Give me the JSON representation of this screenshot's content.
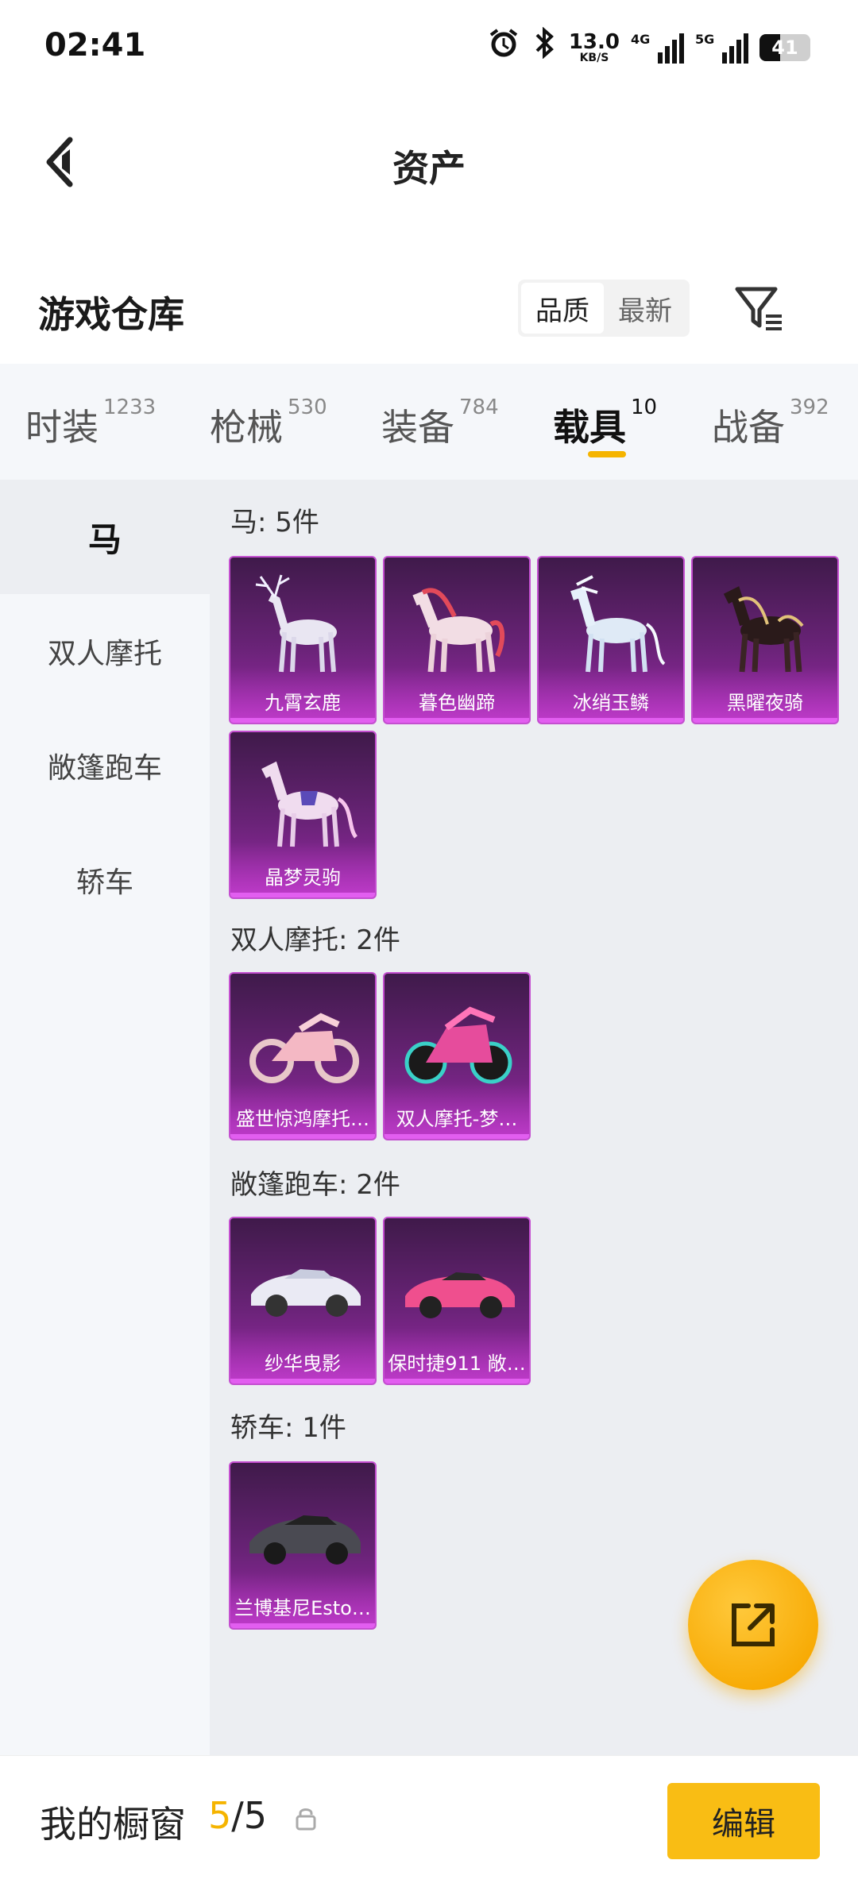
{
  "status": {
    "time": "02:41",
    "net_speed_value": "13.0",
    "net_speed_unit": "KB/S",
    "signal1_label": "4G",
    "signal2_label": "5G",
    "battery": "41",
    "battery_level": 0.41
  },
  "header": {
    "title": "资产",
    "back_icon": "chevron-left-icon"
  },
  "warehouse": {
    "title": "游戏仓库",
    "sort_options": [
      "品质",
      "最新"
    ],
    "sort_selected": "品质"
  },
  "tabs": [
    {
      "label": "时装",
      "count": "1233"
    },
    {
      "label": "枪械",
      "count": "530"
    },
    {
      "label": "装备",
      "count": "784"
    },
    {
      "label": "载具",
      "count": "10",
      "active": true
    },
    {
      "label": "战备",
      "count": "392"
    }
  ],
  "sidebar": [
    "马",
    "双人摩托",
    "敞篷跑车",
    "轿车"
  ],
  "sections": [
    {
      "title": "马: 5件",
      "items": [
        "九霄玄鹿",
        "暮色幽蹄",
        "冰绡玉鳞",
        "黑曜夜骑",
        "晶梦灵驹"
      ]
    },
    {
      "title": "双人摩托: 2件",
      "items": [
        "盛世惊鸿摩托…",
        "双人摩托-梦…"
      ]
    },
    {
      "title": "敞篷跑车: 2件",
      "items": [
        "纱华曳影",
        "保时捷911 敞…"
      ]
    },
    {
      "title": "轿车: 1件",
      "items": [
        "兰博基尼Esto…"
      ]
    }
  ],
  "bottom": {
    "title": "我的橱窗",
    "count_current": "5",
    "count_sep": "/",
    "count_total": "5",
    "edit_label": "编辑"
  },
  "colors": {
    "accent": "#f5b400",
    "card_border": "#c44fd0",
    "button": "#f9bd14"
  }
}
